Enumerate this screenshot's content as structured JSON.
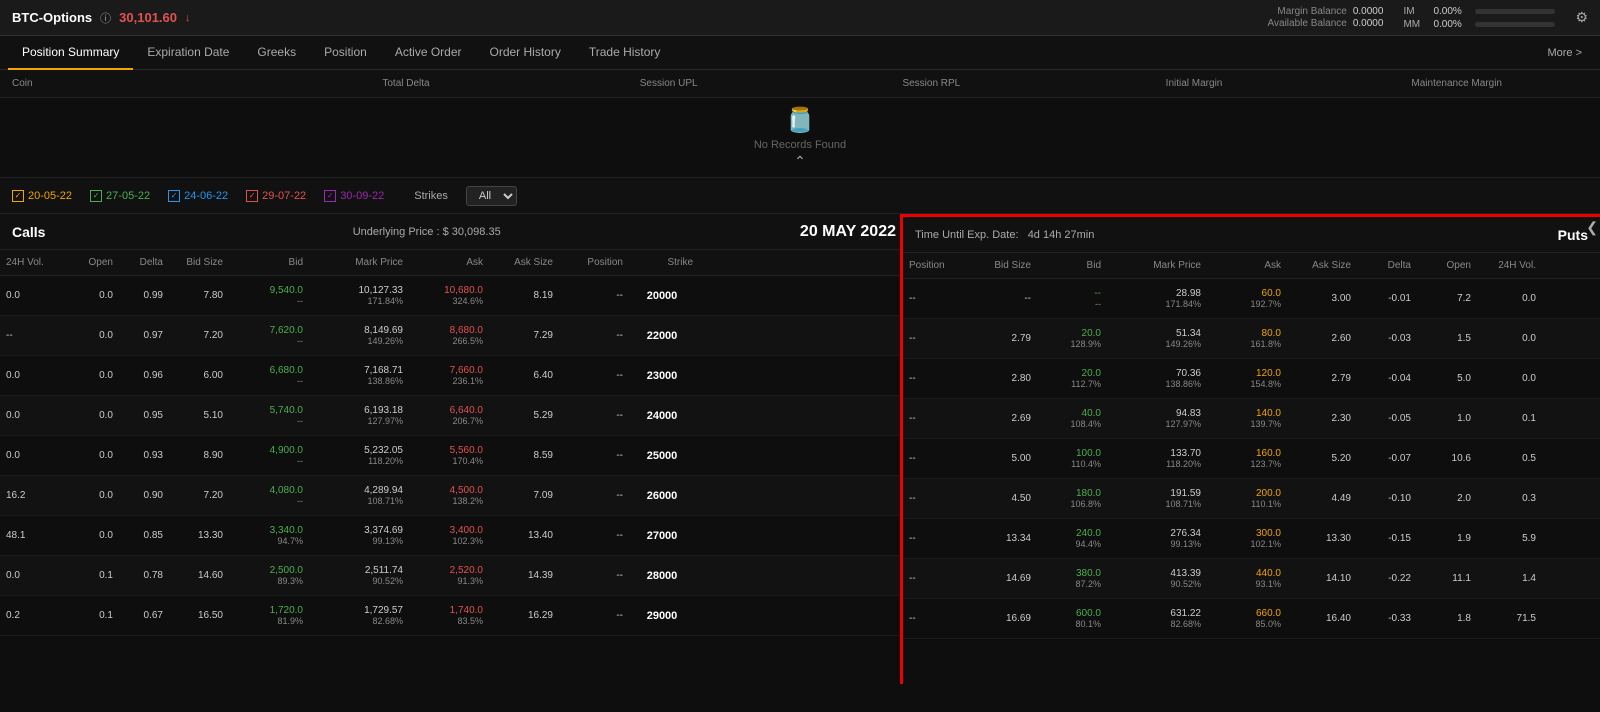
{
  "topbar": {
    "brand": "BTC-Options",
    "brand_icon": "ⓘ",
    "price": "30,101.60",
    "price_arrow": "↓",
    "margin_balance_label": "Margin Balance",
    "margin_balance_val": "0.0000",
    "available_balance_label": "Available Balance",
    "available_balance_val": "0.0000",
    "im_label": "IM",
    "im_pct": "0.00%",
    "mm_label": "MM",
    "mm_pct": "0.00%",
    "gear_icon": "⚙"
  },
  "nav": {
    "tabs": [
      {
        "label": "Position Summary",
        "active": true
      },
      {
        "label": "Expiration Date",
        "active": false
      },
      {
        "label": "Greeks",
        "active": false
      },
      {
        "label": "Position",
        "active": false
      },
      {
        "label": "Active Order",
        "active": false
      },
      {
        "label": "Order History",
        "active": false
      },
      {
        "label": "Trade History",
        "active": false
      }
    ],
    "more": "More >"
  },
  "col_headers": {
    "coin": "Coin",
    "total_delta": "Total Delta",
    "session_upl": "Session UPL",
    "session_rpl": "Session RPL",
    "initial_margin": "Initial Margin",
    "maintenance_margin": "Maintenance Margin"
  },
  "no_records": {
    "icon": "🫙",
    "text": "No Records Found"
  },
  "date_filters": [
    {
      "date": "20-05-22",
      "color": "#f0a500",
      "checked": true
    },
    {
      "date": "27-05-22",
      "color": "#4caf50",
      "checked": true
    },
    {
      "date": "24-06-22",
      "color": "#2196f3",
      "checked": true
    },
    {
      "date": "29-07-22",
      "color": "#e05252",
      "checked": true
    },
    {
      "date": "30-09-22",
      "color": "#9c27b0",
      "checked": true
    }
  ],
  "strikes_label": "Strikes",
  "strikes_value": "All",
  "calls_label": "Calls",
  "puts_label": "Puts",
  "underlying_price": "Underlying Price : $ 30,098.35",
  "date_label": "20 MAY 2022",
  "time_until": "Time Until Exp. Date:",
  "time_until_value": "4d 14h 27min",
  "collapse_icon": "❮",
  "calls_columns": [
    "24H Vol.",
    "Open",
    "Delta",
    "Bid Size",
    "Bid",
    "Mark Price",
    "Ask",
    "Ask Size",
    "Position",
    "Strike"
  ],
  "puts_columns": [
    "Position",
    "Bid Size",
    "Bid",
    "Mark Price",
    "Ask",
    "Ask Size",
    "Delta",
    "Open",
    "24H Vol."
  ],
  "calls_rows": [
    {
      "vol24h": "0.0",
      "open": "0.0",
      "delta": "0.99",
      "bid_size": "7.80",
      "bid": "9,540.0\n--",
      "mark": "10,127.33\n171.84%",
      "ask": "10,680.0\n324.6%",
      "ask_size": "8.19",
      "position": "--",
      "strike": "20000"
    },
    {
      "vol24h": "--",
      "open": "0.0",
      "delta": "0.97",
      "bid_size": "7.20",
      "bid": "7,620.0\n--",
      "mark": "8,149.69\n149.26%",
      "ask": "8,680.0\n266.5%",
      "ask_size": "7.29",
      "position": "--",
      "strike": "22000"
    },
    {
      "vol24h": "0.0",
      "open": "0.0",
      "delta": "0.96",
      "bid_size": "6.00",
      "bid": "6,680.0\n--",
      "mark": "7,168.71\n138.86%",
      "ask": "7,660.0\n236.1%",
      "ask_size": "6.40",
      "position": "--",
      "strike": "23000"
    },
    {
      "vol24h": "0.0",
      "open": "0.0",
      "delta": "0.95",
      "bid_size": "5.10",
      "bid": "5,740.0\n--",
      "mark": "6,193.18\n127.97%",
      "ask": "6,640.0\n206.7%",
      "ask_size": "5.29",
      "position": "--",
      "strike": "24000"
    },
    {
      "vol24h": "0.0",
      "open": "0.0",
      "delta": "0.93",
      "bid_size": "8.90",
      "bid": "4,900.0\n--",
      "mark": "5,232.05\n118.20%",
      "ask": "5,560.0\n170.4%",
      "ask_size": "8.59",
      "position": "--",
      "strike": "25000"
    },
    {
      "vol24h": "16.2",
      "open": "0.0",
      "delta": "0.90",
      "bid_size": "7.20",
      "bid": "4,080.0\n--",
      "mark": "4,289.94\n108.71%",
      "ask": "4,500.0\n138.2%",
      "ask_size": "7.09",
      "position": "--",
      "strike": "26000"
    },
    {
      "vol24h": "48.1",
      "open": "0.0",
      "delta": "0.85",
      "bid_size": "13.30",
      "bid": "3,340.0\n94.7%",
      "mark": "3,374.69\n99.13%",
      "ask": "3,400.0\n102.3%",
      "ask_size": "13.40",
      "position": "--",
      "strike": "27000"
    },
    {
      "vol24h": "0.0",
      "open": "0.1",
      "delta": "0.78",
      "bid_size": "14.60",
      "bid": "2,500.0\n89.3%",
      "mark": "2,511.74\n90.52%",
      "ask": "2,520.0\n91.3%",
      "ask_size": "14.39",
      "position": "--",
      "strike": "28000"
    },
    {
      "vol24h": "0.2",
      "open": "0.1",
      "delta": "0.67",
      "bid_size": "16.50",
      "bid": "1,720.0\n81.9%",
      "mark": "1,729.57\n82.68%",
      "ask": "1,740.0\n83.5%",
      "ask_size": "16.29",
      "position": "--",
      "strike": "29000"
    }
  ],
  "puts_rows": [
    {
      "position": "--",
      "bid_size": "--",
      "bid": "--\n--",
      "mark": "28.98\n171.84%",
      "ask": "60.0\n192.7%",
      "ask_size": "3.00",
      "delta": "-0.01",
      "open": "7.2",
      "vol24h": "0.0"
    },
    {
      "position": "--",
      "bid_size": "2.79",
      "bid": "20.0\n128.9%",
      "mark": "51.34\n149.26%",
      "ask": "80.0\n161.8%",
      "ask_size": "2.60",
      "delta": "-0.03",
      "open": "1.5",
      "vol24h": "0.0"
    },
    {
      "position": "--",
      "bid_size": "2.80",
      "bid": "20.0\n112.7%",
      "mark": "70.36\n138.86%",
      "ask": "120.0\n154.8%",
      "ask_size": "2.79",
      "delta": "-0.04",
      "open": "5.0",
      "vol24h": "0.0"
    },
    {
      "position": "--",
      "bid_size": "2.69",
      "bid": "40.0\n108.4%",
      "mark": "94.83\n127.97%",
      "ask": "140.0\n139.7%",
      "ask_size": "2.30",
      "delta": "-0.05",
      "open": "1.0",
      "vol24h": "0.1"
    },
    {
      "position": "--",
      "bid_size": "5.00",
      "bid": "100.0\n110.4%",
      "mark": "133.70\n118.20%",
      "ask": "160.0\n123.7%",
      "ask_size": "5.20",
      "delta": "-0.07",
      "open": "10.6",
      "vol24h": "0.5"
    },
    {
      "position": "--",
      "bid_size": "4.50",
      "bid": "180.0\n106.8%",
      "mark": "191.59\n108.71%",
      "ask": "200.0\n110.1%",
      "ask_size": "4.49",
      "delta": "-0.10",
      "open": "2.0",
      "vol24h": "0.3"
    },
    {
      "position": "--",
      "bid_size": "13.34",
      "bid": "240.0\n94.4%",
      "mark": "276.34\n99.13%",
      "ask": "300.0\n102.1%",
      "ask_size": "13.30",
      "delta": "-0.15",
      "open": "1.9",
      "vol24h": "5.9"
    },
    {
      "position": "--",
      "bid_size": "14.69",
      "bid": "380.0\n87.2%",
      "mark": "413.39\n90.52%",
      "ask": "440.0\n93.1%",
      "ask_size": "14.10",
      "delta": "-0.22",
      "open": "11.1",
      "vol24h": "1.4"
    },
    {
      "position": "--",
      "bid_size": "16.69",
      "bid": "600.0\n80.1%",
      "mark": "631.22\n82.68%",
      "ask": "660.0\n85.0%",
      "ask_size": "16.40",
      "delta": "-0.33",
      "open": "1.8",
      "vol24h": "71.5"
    }
  ]
}
